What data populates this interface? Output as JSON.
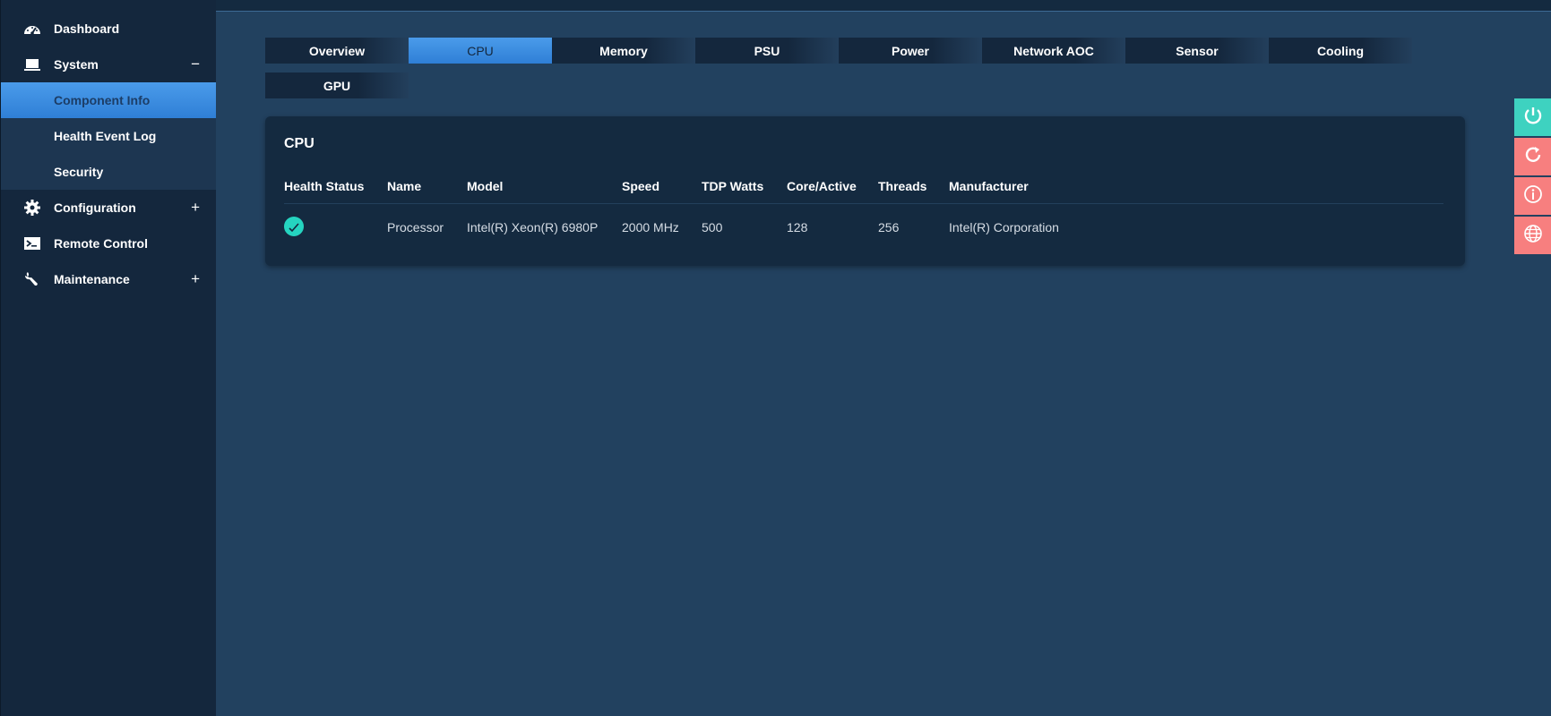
{
  "sidebar": {
    "dashboard": "Dashboard",
    "system": {
      "label": "System",
      "toggle": "−"
    },
    "system_items": [
      "Component Info",
      "Health Event Log",
      "Security"
    ],
    "configuration": {
      "label": "Configuration",
      "toggle": "+"
    },
    "remote_control": "Remote Control",
    "maintenance": {
      "label": "Maintenance",
      "toggle": "+"
    }
  },
  "tabs": [
    "Overview",
    "CPU",
    "Memory",
    "PSU",
    "Power",
    "Network AOC",
    "Sensor",
    "Cooling",
    "GPU"
  ],
  "active_tab": "CPU",
  "panel": {
    "title": "CPU",
    "headers": [
      "Health Status",
      "Name",
      "Model",
      "Speed",
      "TDP Watts",
      "Core/Active",
      "Threads",
      "Manufacturer"
    ],
    "rows": [
      {
        "health": "ok",
        "name": "Processor",
        "model": "Intel(R) Xeon(R) 6980P",
        "speed": "2000 MHz",
        "tdp": "500",
        "cores": "128",
        "threads": "256",
        "manufacturer": "Intel(R) Corporation"
      }
    ]
  },
  "actions": [
    "power-icon",
    "refresh-icon",
    "info-icon",
    "globe-icon"
  ],
  "colors": {
    "accent": "#3a8ce0",
    "ok": "#25d4c0",
    "danger": "#f77f7f",
    "sidebar": "#14273d",
    "background": "#22415f"
  }
}
